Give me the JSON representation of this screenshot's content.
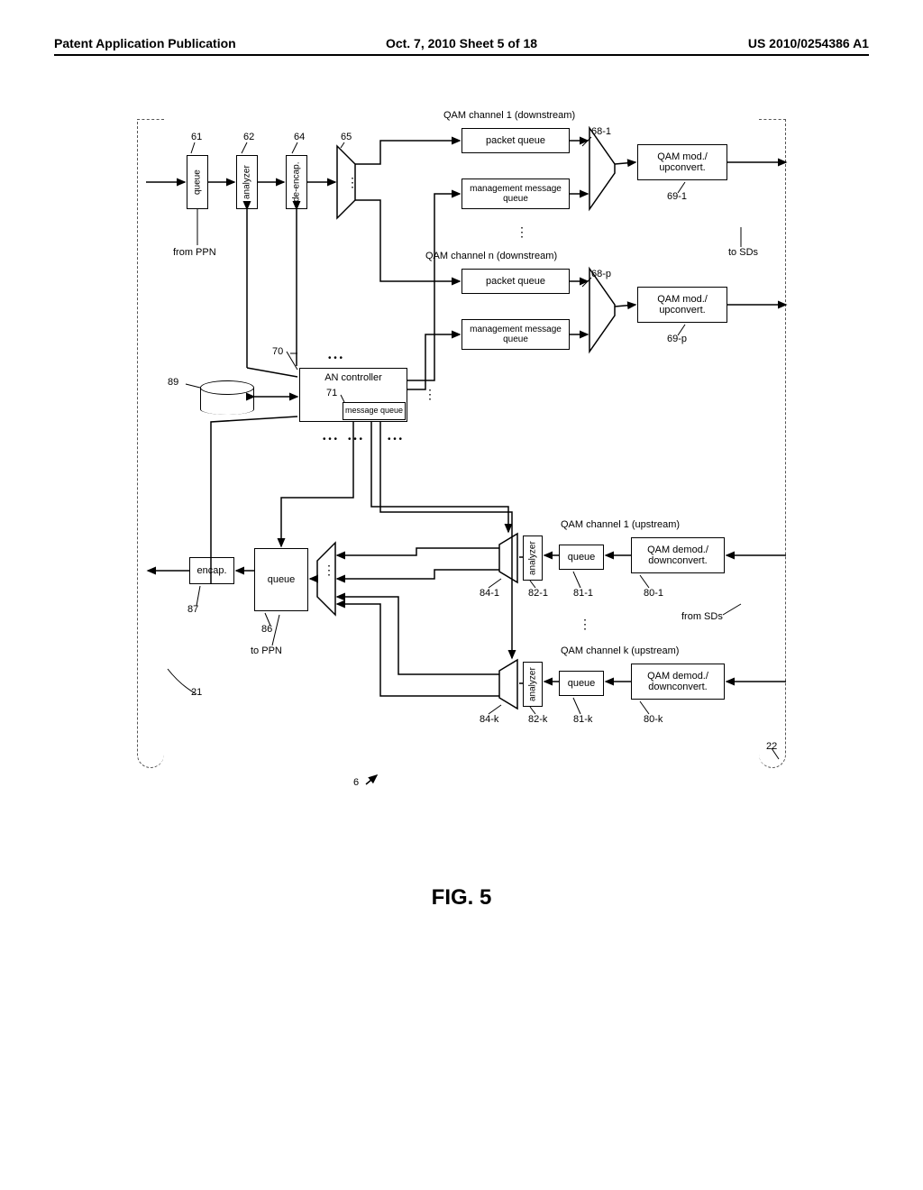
{
  "header": {
    "left": "Patent Application Publication",
    "mid": "Oct. 7, 2010   Sheet 5 of 18",
    "right": "US 2010/0254386 A1"
  },
  "fig": {
    "qam_ch1_down": "QAM channel 1 (downstream)",
    "qam_chn_down": "QAM channel n (downstream)",
    "qam_ch1_up": "QAM channel 1 (upstream)",
    "qam_chk_up": "QAM channel k (upstream)",
    "packet_queue": "packet queue",
    "mgmt_queue": "management message queue",
    "qam_mod": "QAM mod./ upconvert.",
    "qam_demod": "QAM demod./ downconvert.",
    "queue": "queue",
    "analyzer": "analyzer",
    "de_encap": "de-encap.",
    "encap": "encap.",
    "an_controller": "AN controller",
    "message_queue": "message queue",
    "from_ppn": "from PPN",
    "to_ppn": "to PPN",
    "to_sds": "to SDs",
    "from_sds": "from SDs",
    "caption": "FIG. 5"
  },
  "refs": {
    "r61": "61",
    "r62": "62",
    "r64": "64",
    "r65": "65",
    "r68_1": "68-1",
    "r69_1": "69-1",
    "r68_p": "68-p",
    "r69_p": "69-p",
    "r70": "70",
    "r71": "71",
    "r89": "89",
    "r87": "87",
    "r86": "86",
    "r84_1": "84-1",
    "r82_1": "82-1",
    "r81_1": "81-1",
    "r80_1": "80-1",
    "r84_k": "84-k",
    "r82_k": "82-k",
    "r81_k": "81-k",
    "r80_k": "80-k",
    "r21": "21",
    "r22": "22",
    "r6": "6"
  }
}
